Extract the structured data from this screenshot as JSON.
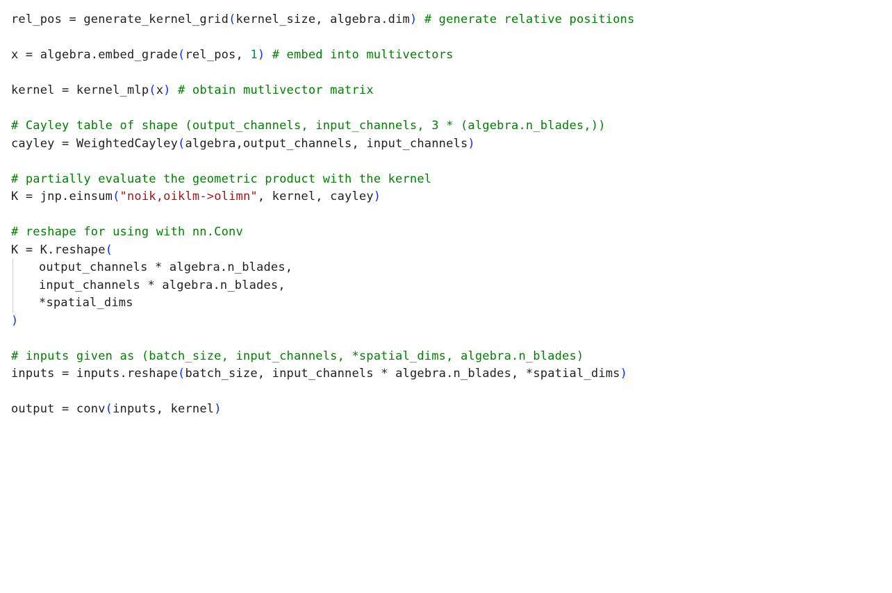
{
  "code_lines": [
    [
      {
        "t": "rel_pos ",
        "c": "tk-default"
      },
      {
        "t": "=",
        "c": "tk-op"
      },
      {
        "t": " generate_kernel_grid",
        "c": "tk-default"
      },
      {
        "t": "(",
        "c": "tk-paren"
      },
      {
        "t": "kernel_size, algebra.dim",
        "c": "tk-default"
      },
      {
        "t": ")",
        "c": "tk-paren"
      },
      {
        "t": " ",
        "c": "tk-default"
      },
      {
        "t": "# generate relative positions",
        "c": "tk-comment"
      }
    ],
    [],
    [
      {
        "t": "x ",
        "c": "tk-default"
      },
      {
        "t": "=",
        "c": "tk-op"
      },
      {
        "t": " algebra.embed_grade",
        "c": "tk-default"
      },
      {
        "t": "(",
        "c": "tk-paren"
      },
      {
        "t": "rel_pos, ",
        "c": "tk-default"
      },
      {
        "t": "1",
        "c": "tk-num"
      },
      {
        "t": ")",
        "c": "tk-paren"
      },
      {
        "t": " ",
        "c": "tk-default"
      },
      {
        "t": "# embed into multivectors",
        "c": "tk-comment"
      }
    ],
    [],
    [
      {
        "t": "kernel ",
        "c": "tk-default"
      },
      {
        "t": "=",
        "c": "tk-op"
      },
      {
        "t": " kernel_mlp",
        "c": "tk-default"
      },
      {
        "t": "(",
        "c": "tk-paren"
      },
      {
        "t": "x",
        "c": "tk-default"
      },
      {
        "t": ")",
        "c": "tk-paren"
      },
      {
        "t": " ",
        "c": "tk-default"
      },
      {
        "t": "# obtain mutlivector matrix",
        "c": "tk-comment"
      }
    ],
    [],
    [
      {
        "t": "# Cayley table of shape (output_channels, input_channels, 3 * (algebra.n_blades,))",
        "c": "tk-comment"
      }
    ],
    [
      {
        "t": "cayley ",
        "c": "tk-default"
      },
      {
        "t": "=",
        "c": "tk-op"
      },
      {
        "t": " WeightedCayley",
        "c": "tk-default"
      },
      {
        "t": "(",
        "c": "tk-paren"
      },
      {
        "t": "algebra,output_channels, input_channels",
        "c": "tk-default"
      },
      {
        "t": ")",
        "c": "tk-paren"
      }
    ],
    [],
    [
      {
        "t": "# partially evaluate the geometric product with the kernel",
        "c": "tk-comment"
      }
    ],
    [
      {
        "t": "K ",
        "c": "tk-default"
      },
      {
        "t": "=",
        "c": "tk-op"
      },
      {
        "t": " jnp.einsum",
        "c": "tk-default"
      },
      {
        "t": "(",
        "c": "tk-paren"
      },
      {
        "t": "\"noik,oiklm->olimn\"",
        "c": "tk-str"
      },
      {
        "t": ", kernel, cayley",
        "c": "tk-default"
      },
      {
        "t": ")",
        "c": "tk-paren"
      }
    ],
    [],
    [
      {
        "t": "# reshape for using with nn.Conv",
        "c": "tk-comment"
      }
    ],
    [
      {
        "t": "K ",
        "c": "tk-default"
      },
      {
        "t": "=",
        "c": "tk-op"
      },
      {
        "t": " K.reshape",
        "c": "tk-default"
      },
      {
        "t": "(",
        "c": "tk-paren"
      }
    ],
    [
      {
        "t": "INDENT",
        "c": "indent"
      },
      {
        "t": "output_channels ",
        "c": "tk-default"
      },
      {
        "t": "*",
        "c": "tk-op"
      },
      {
        "t": " algebra.n_blades,",
        "c": "tk-default"
      }
    ],
    [
      {
        "t": "INDENT",
        "c": "indent"
      },
      {
        "t": "input_channels ",
        "c": "tk-default"
      },
      {
        "t": "*",
        "c": "tk-op"
      },
      {
        "t": " algebra.n_blades,",
        "c": "tk-default"
      }
    ],
    [
      {
        "t": "INDENT",
        "c": "indent"
      },
      {
        "t": "*",
        "c": "tk-op"
      },
      {
        "t": "spatial_dims",
        "c": "tk-default"
      }
    ],
    [
      {
        "t": ")",
        "c": "tk-paren"
      }
    ],
    [],
    [
      {
        "t": "# inputs given as (batch_size, input_channels, *spatial_dims, algebra.n_blades)",
        "c": "tk-comment"
      }
    ],
    [
      {
        "t": "inputs ",
        "c": "tk-default"
      },
      {
        "t": "=",
        "c": "tk-op"
      },
      {
        "t": " inputs.reshape",
        "c": "tk-default"
      },
      {
        "t": "(",
        "c": "tk-paren"
      },
      {
        "t": "batch_size, input_channels ",
        "c": "tk-default"
      },
      {
        "t": "*",
        "c": "tk-op"
      },
      {
        "t": " algebra.n_blades, ",
        "c": "tk-default"
      },
      {
        "t": "*",
        "c": "tk-op"
      },
      {
        "t": "spatial_dims",
        "c": "tk-default"
      },
      {
        "t": ")",
        "c": "tk-paren"
      }
    ],
    [],
    [
      {
        "t": "output ",
        "c": "tk-default"
      },
      {
        "t": "=",
        "c": "tk-op"
      },
      {
        "t": " conv",
        "c": "tk-default"
      },
      {
        "t": "(",
        "c": "tk-paren"
      },
      {
        "t": "inputs, kernel",
        "c": "tk-default"
      },
      {
        "t": ")",
        "c": "tk-paren"
      }
    ]
  ]
}
